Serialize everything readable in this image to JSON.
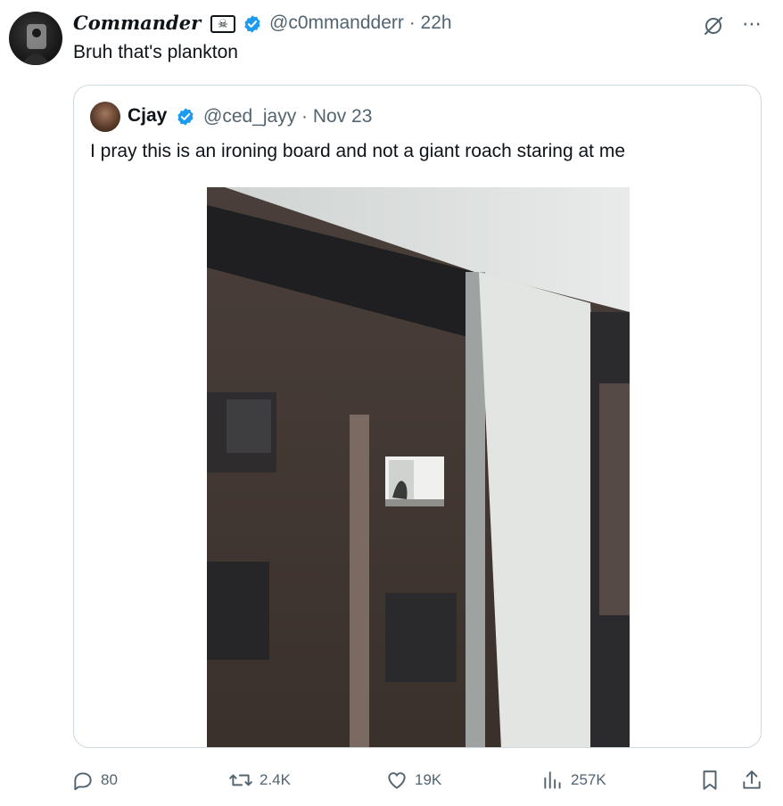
{
  "tweet": {
    "author_name": "Commander",
    "author_badge": "☠",
    "author_handle": "@c0mmandderr",
    "time": "22h",
    "handle_time": "@c0mmandderr · 22h",
    "text": "Bruh that's plankton"
  },
  "quoted": {
    "author_name": "Cjay",
    "author_handle": "@ced_jayy",
    "date": "Nov 23",
    "handle_date": "@ced_jayy · Nov 23",
    "text": "I pray this is an ironing board and not a giant roach staring at me",
    "image_content": "Night photo through a window of a brown apartment building with a lit window showing a silhouette"
  },
  "actions": {
    "replies": "80",
    "reposts": "2.4K",
    "likes": "19K",
    "views": "257K"
  },
  "icons": [
    "reply-icon",
    "repost-icon",
    "like-icon",
    "views-icon",
    "bookmark-icon",
    "share-icon",
    "grok-icon",
    "more-icon",
    "verified-icon"
  ],
  "colors": {
    "text": "#0f1419",
    "secondary": "#536471",
    "verified": "#1d9bf0",
    "border": "#cfd9de"
  }
}
